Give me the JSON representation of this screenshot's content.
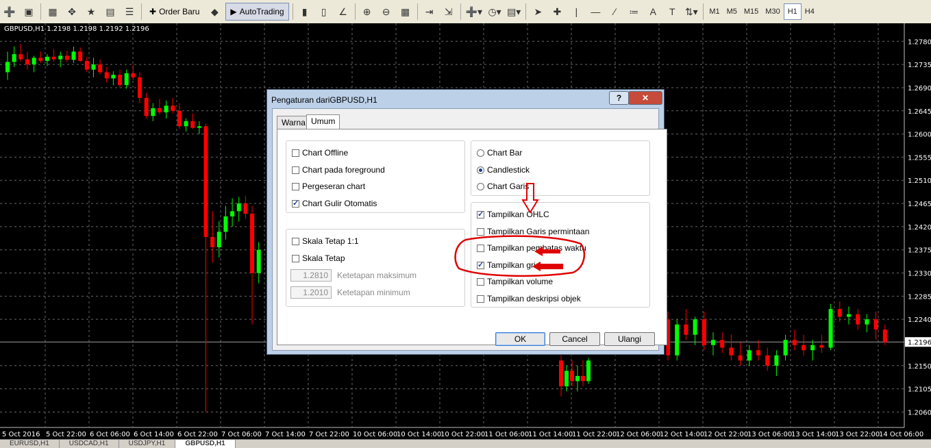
{
  "toolbar": {
    "order_baru_label": "Order Baru",
    "autotrading_label": "AutoTrading",
    "timeframes": [
      "M1",
      "M5",
      "M15",
      "M30",
      "H1",
      "H4"
    ],
    "active_timeframe": "H1",
    "icons": [
      "new-chart-icon",
      "profiles-icon",
      "market-watch-icon",
      "navigator-icon",
      "favorites-icon",
      "terminal-icon",
      "strategy-tester-icon",
      "order-icon",
      "metaeditor-icon",
      "autotrading-icon",
      "bar-chart-icon",
      "candlestick-icon",
      "line-chart-icon",
      "zoom-in-icon",
      "zoom-out-icon",
      "tile-windows-icon",
      "chart-shift-icon",
      "autoscroll-icon",
      "indicators-icon",
      "periods-icon",
      "templates-icon",
      "cursor-icon",
      "crosshair-icon",
      "vertical-line-icon",
      "horizontal-line-icon",
      "trendline-icon",
      "fibonacci-icon",
      "text-icon",
      "text-label-icon",
      "arrows-icon"
    ]
  },
  "chart": {
    "label": "GBPUSD,H1  1.2198 1.2198 1.2192 1.2196",
    "price_ticks": [
      "1.2780",
      "1.2735",
      "1.2690",
      "1.2645",
      "1.2600",
      "1.2555",
      "1.2510",
      "1.2465",
      "1.2420",
      "1.2375",
      "1.2330",
      "1.2285",
      "1.2240",
      "1.2196",
      "1.2150",
      "1.2105",
      "1.2060"
    ],
    "current_price": "1.2196",
    "time_ticks": [
      "5 Oct 2016",
      "5 Oct 22:00",
      "6 Oct 06:00",
      "6 Oct 14:00",
      "6 Oct 22:00",
      "7 Oct 06:00",
      "7 Oct 14:00",
      "7 Oct 22:00",
      "10 Oct 06:00",
      "10 Oct 14:00",
      "10 Oct 22:00",
      "11 Oct 06:00",
      "11 Oct 14:00",
      "11 Oct 22:00",
      "12 Oct 06:00",
      "12 Oct 14:00",
      "12 Oct 22:00",
      "13 Oct 06:00",
      "13 Oct 14:00",
      "13 Oct 22:00",
      "14 Oct 06:00"
    ],
    "colors": {
      "background": "#000000",
      "grid": "#6a6a6a",
      "bull": "#00ff00",
      "bear": "#ff0000",
      "text": "#ffffff"
    }
  },
  "chart_data": {
    "type": "candlestick",
    "ylim": [
      1.203,
      1.2815
    ],
    "candles": [
      [
        1.272,
        1.276,
        1.2705,
        1.274
      ],
      [
        1.274,
        1.277,
        1.273,
        1.2755
      ],
      [
        1.2755,
        1.2775,
        1.274,
        1.2745
      ],
      [
        1.2745,
        1.276,
        1.2725,
        1.2735
      ],
      [
        1.2735,
        1.2752,
        1.272,
        1.2748
      ],
      [
        1.2748,
        1.276,
        1.2738,
        1.2742
      ],
      [
        1.2742,
        1.2755,
        1.2732,
        1.275
      ],
      [
        1.275,
        1.2765,
        1.274,
        1.2745
      ],
      [
        1.2745,
        1.276,
        1.273,
        1.2752
      ],
      [
        1.2752,
        1.2762,
        1.274,
        1.2744
      ],
      [
        1.2744,
        1.277,
        1.2738,
        1.276
      ],
      [
        1.276,
        1.2768,
        1.274,
        1.2742
      ],
      [
        1.2742,
        1.275,
        1.272,
        1.2725
      ],
      [
        1.2725,
        1.2748,
        1.271,
        1.2735
      ],
      [
        1.2735,
        1.2745,
        1.2715,
        1.272
      ],
      [
        1.272,
        1.273,
        1.27,
        1.2708
      ],
      [
        1.2708,
        1.2722,
        1.2695,
        1.2715
      ],
      [
        1.2715,
        1.2725,
        1.269,
        1.2695
      ],
      [
        1.2695,
        1.2725,
        1.2688,
        1.2718
      ],
      [
        1.2718,
        1.2735,
        1.2705,
        1.271
      ],
      [
        1.271,
        1.272,
        1.266,
        1.267
      ],
      [
        1.267,
        1.268,
        1.263,
        1.2635
      ],
      [
        1.2635,
        1.266,
        1.2625,
        1.265
      ],
      [
        1.265,
        1.2668,
        1.2638,
        1.2642
      ],
      [
        1.2642,
        1.2665,
        1.263,
        1.2655
      ],
      [
        1.2655,
        1.267,
        1.264,
        1.2645
      ],
      [
        1.2645,
        1.266,
        1.261,
        1.2615
      ],
      [
        1.2615,
        1.263,
        1.2605,
        1.2625
      ],
      [
        1.2625,
        1.264,
        1.261,
        1.2612
      ],
      [
        1.2612,
        1.2625,
        1.26,
        1.2615
      ],
      [
        1.2615,
        1.262,
        1.206,
        1.24
      ],
      [
        1.24,
        1.245,
        1.235,
        1.238
      ],
      [
        1.238,
        1.243,
        1.236,
        1.241
      ],
      [
        1.241,
        1.246,
        1.2395,
        1.244
      ],
      [
        1.244,
        1.2475,
        1.242,
        1.245
      ],
      [
        1.245,
        1.2478,
        1.243,
        1.2465
      ],
      [
        1.2465,
        1.248,
        1.2435,
        1.2445
      ],
      [
        1.2445,
        1.246,
        1.223,
        1.233
      ],
      [
        1.233,
        1.239,
        1.231,
        1.2375
      ]
    ]
  },
  "dialog": {
    "title": "Pengaturan dariGBPUSD,H1",
    "help_label": "?",
    "tabs": [
      "Warna",
      "Umum"
    ],
    "active_tab": "Umum",
    "left_group1": [
      {
        "label": "Chart Offline",
        "checked": false
      },
      {
        "label": "Chart pada foreground",
        "checked": false
      },
      {
        "label": "Pergeseran chart",
        "checked": false
      },
      {
        "label": "Chart Gulir Otomatis",
        "checked": true
      }
    ],
    "left_group2": [
      {
        "label": "Skala Tetap 1:1",
        "checked": false
      },
      {
        "label": "Skala Tetap",
        "checked": false
      }
    ],
    "fixed_max": {
      "value": "1.2810",
      "label": "Ketetapan maksimum"
    },
    "fixed_min": {
      "value": "1.2010",
      "label": "Ketetapan minimum"
    },
    "chart_type": [
      {
        "label": "Chart Bar",
        "checked": false
      },
      {
        "label": "Candlestick",
        "checked": true
      },
      {
        "label": "Chart Garis",
        "checked": false
      }
    ],
    "show_options": [
      {
        "label": "Tampilkan OHLC",
        "checked": true
      },
      {
        "label": "Tampilkan Garis permintaan",
        "checked": false
      },
      {
        "label": "Tampilkan pembatas waktu",
        "checked": false
      },
      {
        "label": "Tampilkan grid",
        "checked": true
      },
      {
        "label": "Tampilkan volume",
        "checked": false
      },
      {
        "label": "Tampilkan deskripsi objek",
        "checked": false
      }
    ],
    "buttons": {
      "ok": "OK",
      "cancel": "Cancel",
      "reset": "Ulangi"
    }
  },
  "bottom_tabs": [
    "EURUSD,H1",
    "USDCAD,H1",
    "USDJPY,H1",
    "GBPUSD,H1"
  ],
  "active_bottom_tab": "GBPUSD,H1"
}
